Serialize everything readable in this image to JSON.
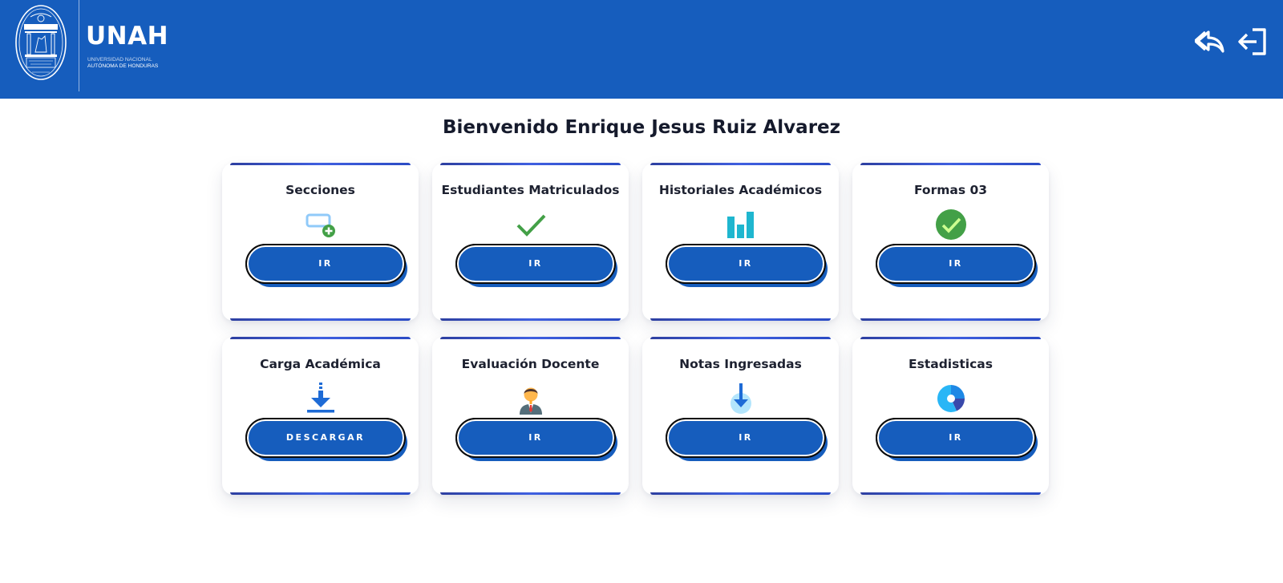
{
  "header": {
    "brand": "UNAH",
    "brand_sub_line1": "UNIVERSIDAD NACIONAL",
    "brand_sub_line2": "AUTÓNOMA DE HONDURAS",
    "seal_text_top": "LUCEM ASPICIO",
    "seal_text_bottom": "UNIVERSIDAD NACIONAL AUTÓNOMA DE HONDURAS",
    "seal_year": "1847",
    "back_icon": "reply-arrow-icon",
    "logout_icon": "logout-icon",
    "background": "#165dbd"
  },
  "welcome": "Bienvenido Enrique Jesus Ruiz Alvarez",
  "cards": [
    {
      "title": "Secciones",
      "button": "IR",
      "icon": "add-section-icon"
    },
    {
      "title": "Estudiantes Matriculados",
      "button": "IR",
      "icon": "checkmark-icon"
    },
    {
      "title": "Historiales Académicos",
      "button": "IR",
      "icon": "bar-chart-icon"
    },
    {
      "title": "Formas 03",
      "button": "IR",
      "icon": "check-circle-icon"
    },
    {
      "title": "Carga Académica",
      "button": "DESCARGAR",
      "icon": "download-icon"
    },
    {
      "title": "Evaluación Docente",
      "button": "IR",
      "icon": "teacher-icon"
    },
    {
      "title": "Notas Ingresadas",
      "button": "IR",
      "icon": "download-circle-icon"
    },
    {
      "title": "Estadisticas",
      "button": "IR",
      "icon": "pie-chart-icon"
    }
  ],
  "colors": {
    "primary": "#165dbd",
    "success_green": "#43a047",
    "teal": "#1fb6cf",
    "accent_blue": "#1e6bd6"
  }
}
